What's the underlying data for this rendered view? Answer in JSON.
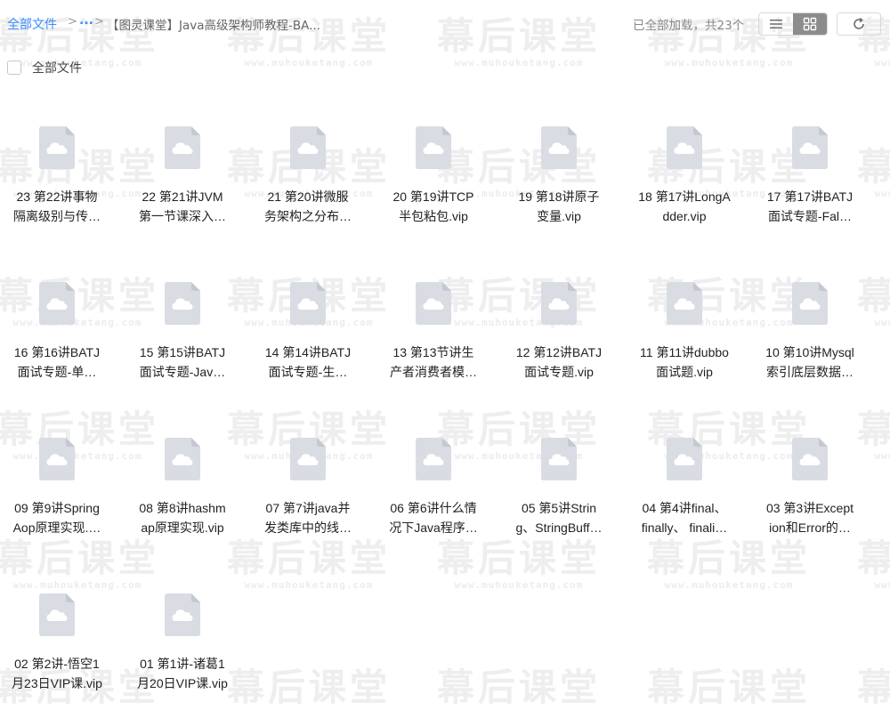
{
  "breadcrumb": {
    "root": "全部文件",
    "ellipsis": "...",
    "current": "【图灵课堂】Java高级架构师教程-BA..."
  },
  "status": {
    "loaded_text": "已全部加载，共23个"
  },
  "toolbar": {
    "list_view_icon": "list-icon",
    "grid_view_icon": "grid-icon",
    "refresh_icon": "refresh-icon",
    "active_view": "grid"
  },
  "select_all": {
    "label": "全部文件",
    "checked": false
  },
  "watermark": {
    "text": "幕后课堂",
    "url": "www.muhouketang.com"
  },
  "colors": {
    "link": "#3b8cff",
    "icon_bg": "#d9dce3",
    "cloud": "#ffffff"
  },
  "files": [
    {
      "line1": "23 第22讲事物",
      "line2": "隔离级别与传…"
    },
    {
      "line1": "22 第21讲JVM",
      "line2": "第一节课深入…"
    },
    {
      "line1": "21 第20讲微服",
      "line2": "务架构之分布…"
    },
    {
      "line1": "20 第19讲TCP",
      "line2": "半包粘包.vip"
    },
    {
      "line1": "19 第18讲原子",
      "line2": "变量.vip"
    },
    {
      "line1": "18 第17讲LongA",
      "line2": "dder.vip"
    },
    {
      "line1": "17 第17讲BATJ",
      "line2": "面试专题-Fal…"
    },
    {
      "line1": "16 第16讲BATJ",
      "line2": "面试专题-单…"
    },
    {
      "line1": "15 第15讲BATJ",
      "line2": "面试专题-Jav…"
    },
    {
      "line1": "14 第14讲BATJ",
      "line2": "面试专题-生…"
    },
    {
      "line1": "13 第13节讲生",
      "line2": "产者消费者模…"
    },
    {
      "line1": "12 第12讲BATJ",
      "line2": "面试专题.vip"
    },
    {
      "line1": "11 第11讲dubbo",
      "line2": "面试题.vip"
    },
    {
      "line1": "10 第10讲Mysql",
      "line2": "索引底层数据…"
    },
    {
      "line1": "09 第9讲Spring",
      "line2": "Aop原理实现.…"
    },
    {
      "line1": "08 第8讲hashm",
      "line2": "ap原理实现.vip"
    },
    {
      "line1": "07 第7讲java并",
      "line2": "发类库中的线…"
    },
    {
      "line1": "06 第6讲什么情",
      "line2": "况下Java程序…"
    },
    {
      "line1": "05 第5讲Strin",
      "line2": "g、StringBuff…"
    },
    {
      "line1": "04 第4讲final、",
      "line2": "finally、 finali…"
    },
    {
      "line1": "03 第3讲Except",
      "line2": "ion和Error的…"
    },
    {
      "line1": "02 第2讲-悟空1",
      "line2": "月23日VIP课.vip"
    },
    {
      "line1": "01 第1讲-诸葛1",
      "line2": "月20日VIP课.vip"
    }
  ]
}
